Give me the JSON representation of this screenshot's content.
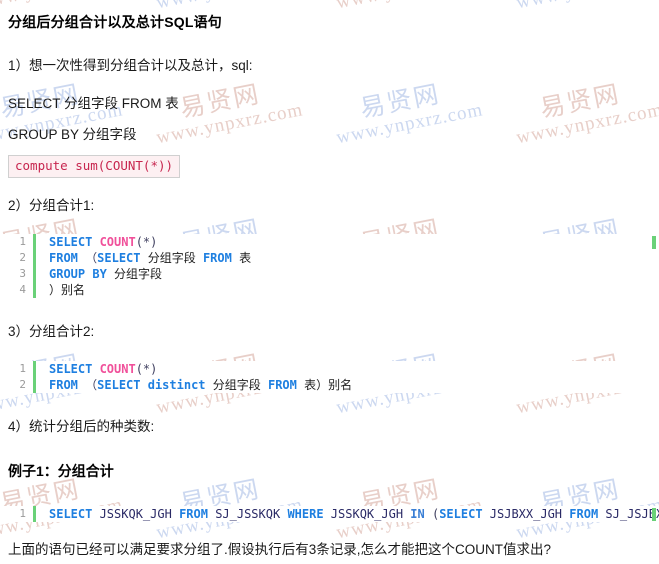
{
  "document": {
    "title": "分组后分组合计以及总计SQL语句",
    "watermark": {
      "cn": "易贤网",
      "url": "www.ynpxrz.com",
      "color_pink": "#e8cfc9",
      "color_blue": "#ccd8f0"
    },
    "sections": [
      {
        "id": "item1",
        "text": "1）想一次性得到分组合计以及总计，sql:"
      },
      {
        "id": "sql_line1",
        "text": "SELECT 分组字段 FROM 表"
      },
      {
        "id": "sql_line2",
        "text": "GROUP BY 分组字段"
      },
      {
        "id": "item2",
        "text": "2）分组合计1:"
      },
      {
        "id": "item3",
        "text": "3）分组合计2:"
      },
      {
        "id": "item4",
        "text": "4）统计分组后的种类数:"
      },
      {
        "id": "example1",
        "text": "例子1：分组合计"
      },
      {
        "id": "closing",
        "text": "上面的语句已经可以满足要求分组了.假设执行后有3条记录,怎么才能把这个COUNT值求出?"
      }
    ],
    "inline_code": {
      "line_numbers_visible": false,
      "tokens": [
        {
          "t": "compute sum",
          "c": "code"
        },
        {
          "t": "(COUNT(*))",
          "c": "punc"
        }
      ],
      "full_text": "compute sum(COUNT(*))"
    },
    "code_blocks": [
      {
        "id": "code-block-1",
        "gutter_color": "#6ad178",
        "end_marker": true,
        "lines": [
          {
            "num": "1",
            "tokens": [
              {
                "t": "SELECT ",
                "c": "kw"
              },
              {
                "t": "COUNT",
                "c": "fn"
              },
              {
                "t": "(*)",
                "c": "punc"
              }
            ]
          },
          {
            "num": "2",
            "tokens": [
              {
                "t": "FROM ",
                "c": "kw"
              },
              {
                "t": "（",
                "c": "punc"
              },
              {
                "t": "SELECT ",
                "c": "kw"
              },
              {
                "t": "分组字段 ",
                "c": "cn"
              },
              {
                "t": "FROM ",
                "c": "kw"
              },
              {
                "t": "表",
                "c": "cn"
              }
            ]
          },
          {
            "num": "3",
            "tokens": [
              {
                "t": "GROUP BY ",
                "c": "kw"
              },
              {
                "t": "分组字段",
                "c": "cn"
              }
            ]
          },
          {
            "num": "4",
            "tokens": [
              {
                "t": "）别名",
                "c": "cn"
              }
            ]
          }
        ]
      },
      {
        "id": "code-block-2",
        "gutter_color": "#6ad178",
        "end_marker": false,
        "lines": [
          {
            "num": "1",
            "tokens": [
              {
                "t": "SELECT ",
                "c": "kw"
              },
              {
                "t": "COUNT",
                "c": "fn"
              },
              {
                "t": "(*)",
                "c": "punc"
              }
            ]
          },
          {
            "num": "2",
            "tokens": [
              {
                "t": "FROM ",
                "c": "kw"
              },
              {
                "t": "（",
                "c": "punc"
              },
              {
                "t": "SELECT ",
                "c": "kw"
              },
              {
                "t": "distinct ",
                "c": "kw"
              },
              {
                "t": "分组字段 ",
                "c": "cn"
              },
              {
                "t": "FROM ",
                "c": "kw"
              },
              {
                "t": "表）别名",
                "c": "cn"
              }
            ]
          }
        ]
      },
      {
        "id": "code-block-3",
        "gutter_color": "#6ad178",
        "end_marker": true,
        "lines": [
          {
            "num": "1",
            "tokens": [
              {
                "t": "SELECT ",
                "c": "kw"
              },
              {
                "t": "JSSKQK_JGH ",
                "c": "id"
              },
              {
                "t": "FROM ",
                "c": "kw"
              },
              {
                "t": "SJ_JSSKQK ",
                "c": "id"
              },
              {
                "t": "WHERE ",
                "c": "kw"
              },
              {
                "t": "JSSKQK_JGH ",
                "c": "id"
              },
              {
                "t": "IN ",
                "c": "kw2"
              },
              {
                "t": "(",
                "c": "punc"
              },
              {
                "t": "SELECT ",
                "c": "kw"
              },
              {
                "t": "JSJBXX_JGH ",
                "c": "id"
              },
              {
                "t": "FROM ",
                "c": "kw"
              },
              {
                "t": "SJ_JSJBXX",
                "c": "id"
              }
            ]
          }
        ]
      }
    ]
  }
}
